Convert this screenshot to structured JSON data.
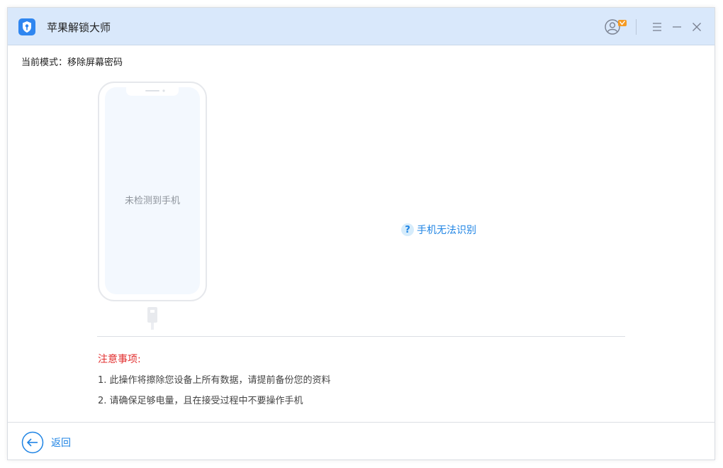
{
  "window": {
    "title": "苹果解锁大师"
  },
  "titlebar": {
    "icons": [
      "user-icon",
      "menu-icon",
      "minimize-icon",
      "close-icon"
    ]
  },
  "main": {
    "mode_label": "当前模式：移除屏幕密码",
    "phone_status": "未检测到手机",
    "help_link": "手机无法识别",
    "help_icon_text": "?",
    "notes": {
      "title": "注意事项:",
      "items": [
        "1. 此操作将擦除您设备上所有数据，请提前备份您的资料",
        "2. 请确保足够电量，且在接受过程中不要操作手机"
      ]
    }
  },
  "footer": {
    "back_label": "返回"
  },
  "colors": {
    "titlebar_bg": "#d9e8fb",
    "accent": "#1f84e4",
    "warning": "#e22f2f"
  }
}
